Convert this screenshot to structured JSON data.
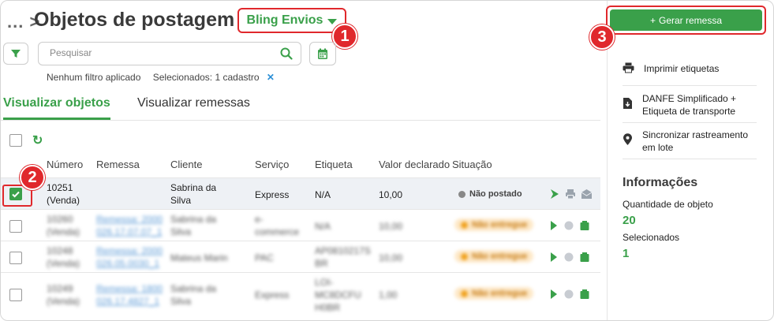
{
  "header": {
    "breadcrumb": "... >",
    "title": "Objetos de postagem",
    "store_selector": "Bling Envios",
    "generate_button": "Gerar remessa"
  },
  "search": {
    "placeholder": "Pesquisar",
    "filter_status": "Nenhum filtro aplicado",
    "selected_status": "Selecionados: 1 cadastro",
    "clear_icon": "close-icon"
  },
  "tabs": [
    "Visualizar objetos",
    "Visualizar remessas"
  ],
  "table": {
    "columns": [
      "Número",
      "Remessa",
      "Cliente",
      "Serviço",
      "Etiqueta",
      "Valor declarado",
      "Situação"
    ],
    "rows": [
      {
        "numero": "10251",
        "numero2": "(Venda)",
        "remessa": "",
        "remessa2": "",
        "cliente": "Sabrina da",
        "cliente2": "Silva",
        "servico": "Express",
        "servico2": "",
        "etiqueta": "N/A",
        "etiqueta2": "",
        "etiqueta3": "",
        "valor": "10,00",
        "situacao": "Não postado",
        "checked": true
      },
      {
        "numero": "10260",
        "numero2": "(Venda)",
        "remessa": "Remessa: 2000",
        "remessa2": "026.17.07.07_1",
        "cliente": "Sabrina da",
        "cliente2": "Silva",
        "servico": "e-",
        "servico2": "commerce",
        "etiqueta": "N/A",
        "etiqueta2": "",
        "etiqueta3": "",
        "valor": "10,00",
        "situacao": "Não entregue",
        "checked": false
      },
      {
        "numero": "10248",
        "numero2": "(Venda)",
        "remessa": "Remessa: 2000",
        "remessa2": "026.05.0030_1",
        "cliente": "Mateus Marin",
        "cliente2": "",
        "servico": "PAC",
        "servico2": "",
        "etiqueta": "AP0810217S",
        "etiqueta2": "BR",
        "etiqueta3": "",
        "valor": "10,00",
        "situacao": "Não entregue",
        "checked": false
      },
      {
        "numero": "10249",
        "numero2": "(Venda)",
        "remessa": "Remessa: 1800",
        "remessa2": "026.17.4827_1",
        "cliente": "Sabrina da",
        "cliente2": "Silva",
        "servico": "Express",
        "servico2": "",
        "etiqueta": "LOI-",
        "etiqueta2": "MC8DCFU",
        "etiqueta3": "H0BR",
        "valor": "1,00",
        "situacao": "Não entregue",
        "checked": false
      }
    ]
  },
  "sidebar": {
    "actions": [
      {
        "label": "Imprimir etiquetas",
        "label2": "",
        "icon": "printer-icon"
      },
      {
        "label": "DANFE Simplificado +",
        "label2": "Etiqueta de transporte",
        "icon": "file-download-icon"
      },
      {
        "label": "Sincronizar rastreamento",
        "label2": "em lote",
        "icon": "location-pin-icon"
      }
    ],
    "info_title": "Informações",
    "qty_label": "Quantidade de objeto",
    "qty_value": "20",
    "selected_label": "Selecionados",
    "selected_value": "1"
  },
  "annotations": [
    "1",
    "2",
    "3"
  ],
  "colors": {
    "accent": "#3aa04a",
    "highlight": "#e0282c",
    "link": "#2b8fd6"
  }
}
